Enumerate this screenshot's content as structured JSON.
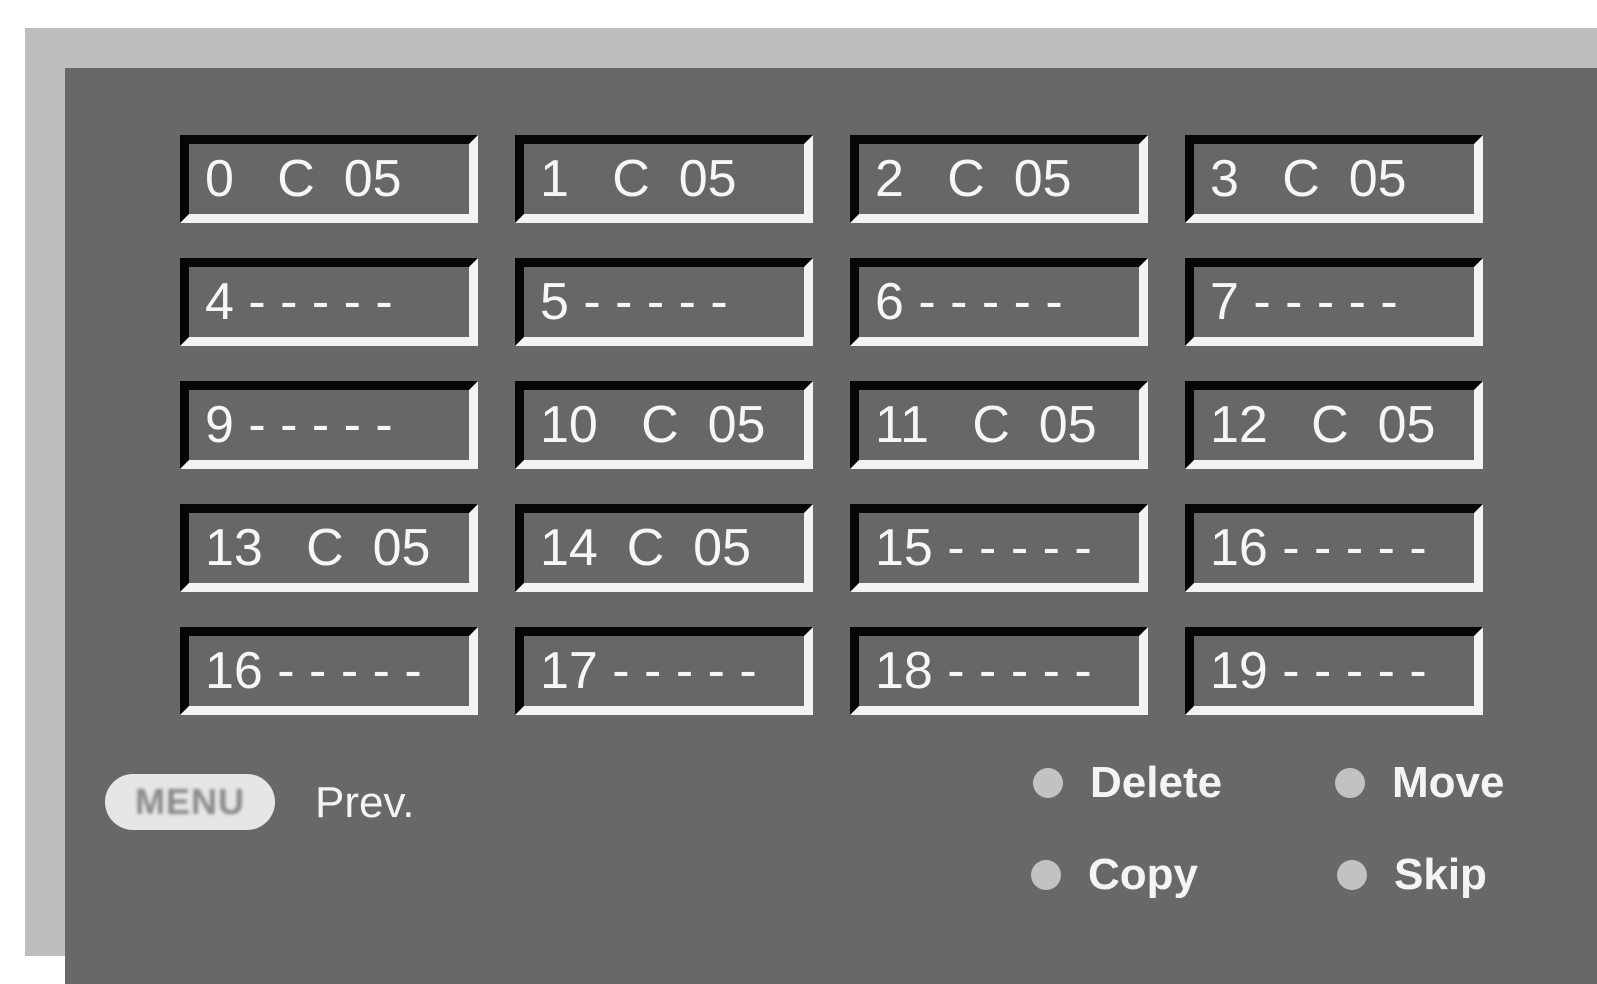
{
  "program_grid": {
    "cells": [
      "0   C  05",
      "1   C  05",
      "2   C  05",
      "3   C  05",
      "4 - - - - -",
      "5 - - - - -",
      "6 - - - - -",
      "7 - - - - -",
      "9 - - - - -",
      "10   C  05",
      "11   C  05",
      "12   C  05",
      "13   C  05",
      "14  C  05",
      "15 - - - - -",
      "16 - - - - -",
      "16 - - - - -",
      "17 - - - - -",
      "18 - - - - -",
      "19 - - - - -"
    ]
  },
  "footer": {
    "menu_button_label": "MENU",
    "prev_label": "Prev.",
    "legend": {
      "delete": "Delete",
      "move": "Move",
      "copy": "Copy",
      "skip": "Skip"
    }
  },
  "colors": {
    "panel_background": "#686868",
    "frame_border": "#bdbdbd",
    "text": "#f4f4f4",
    "legend_dot": "#c2c2c2",
    "cell_shadow": "#060606",
    "cell_highlight": "#f3f3f3"
  },
  "icons": {
    "legend_bullet": "circle-dot-icon"
  }
}
